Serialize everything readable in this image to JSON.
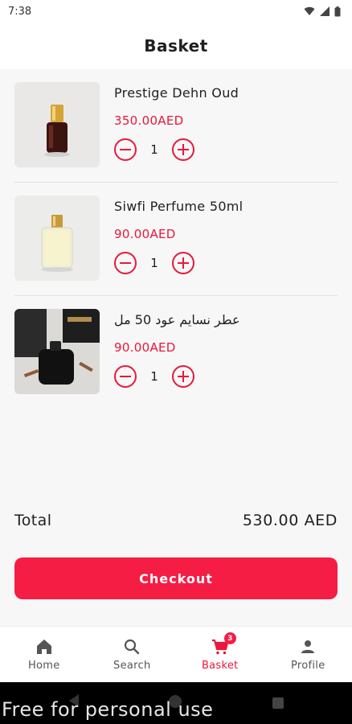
{
  "status_bar": {
    "time": "7:38"
  },
  "header": {
    "title": "Basket"
  },
  "items": [
    {
      "name": "Prestige Dehn Oud",
      "price": "350.00AED",
      "quantity": "1",
      "image": "oud-oil-bottle"
    },
    {
      "name": "Siwfi Perfume 50ml",
      "price": "90.00AED",
      "quantity": "1",
      "image": "perfume-bottle"
    },
    {
      "name": "عطر نسايم عود    50 مل",
      "price": "90.00AED",
      "quantity": "1",
      "image": "black-perfume-box"
    }
  ],
  "summary": {
    "total_label": "Total",
    "total_value": "530.00 AED"
  },
  "checkout": {
    "label": "Checkout"
  },
  "nav": {
    "items": [
      {
        "label": "Home",
        "icon": "home-icon"
      },
      {
        "label": "Search",
        "icon": "search-icon"
      },
      {
        "label": "Basket",
        "icon": "cart-icon",
        "badge": "3",
        "active": true
      },
      {
        "label": "Profile",
        "icon": "person-icon"
      }
    ]
  },
  "watermark": "Free for personal use",
  "colors": {
    "accent": "#f61d45",
    "price": "#e8193b",
    "text": "#1f1f1f"
  }
}
